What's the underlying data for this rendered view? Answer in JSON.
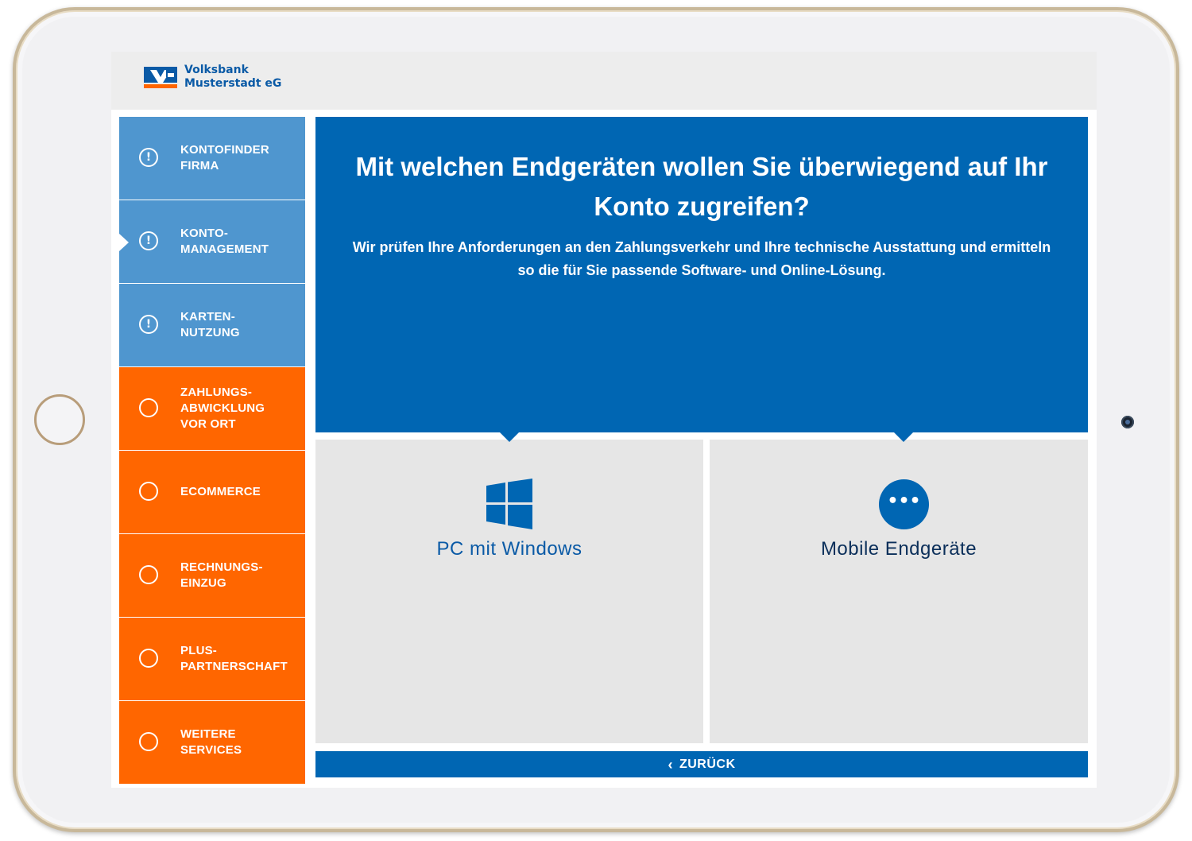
{
  "brand": {
    "line1": "Volksbank",
    "line2": "Musterstadt eG",
    "colors": {
      "blue": "#0066b3",
      "orange": "#ff6600"
    }
  },
  "sidebar": {
    "items": [
      {
        "label": "KONTOFINDER\nFIRMA",
        "icon": "exclamation-icon",
        "state": "done"
      },
      {
        "label": "KONTO-\nMANAGEMENT",
        "icon": "exclamation-icon",
        "state": "active"
      },
      {
        "label": "KARTEN-\nNUTZUNG",
        "icon": "exclamation-icon",
        "state": "done"
      },
      {
        "label": "ZAHLUNGS-\nABWICKLUNG\nVOR ORT",
        "icon": "circle-icon",
        "state": "open"
      },
      {
        "label": "ECOMMERCE",
        "icon": "circle-icon",
        "state": "open"
      },
      {
        "label": "RECHNUNGS-\nEINZUG",
        "icon": "circle-icon",
        "state": "open"
      },
      {
        "label": "PLUS-\nPARTNERSCHAFT",
        "icon": "circle-icon",
        "state": "open"
      },
      {
        "label": "WEITERE\nSERVICES",
        "icon": "circle-icon",
        "state": "open"
      }
    ],
    "icon_glyph": "!"
  },
  "question": {
    "title": "Mit welchen Endgeräten wollen Sie überwiegend auf Ihr Konto zugreifen?",
    "subtitle": "Wir prüfen Ihre Anforderungen an den Zahlungsverkehr und Ihre technische Ausstattung und ermitteln so die für Sie passende Software- und Online-Lösung."
  },
  "options": {
    "pc": {
      "label": "PC mit Windows",
      "icon": "windows-icon"
    },
    "mobile": {
      "label": "Mobile Endgeräte",
      "icon": "more-dots-icon",
      "glyph": "•••"
    }
  },
  "footer": {
    "back_label": "ZURÜCK",
    "back_icon": "chevron-left-icon",
    "back_glyph": "‹"
  }
}
